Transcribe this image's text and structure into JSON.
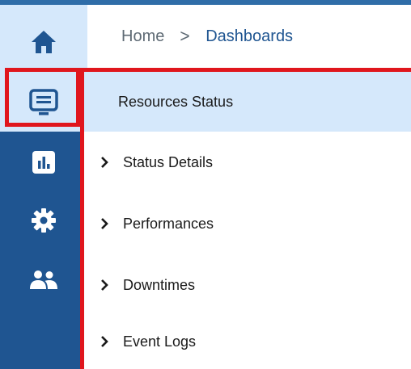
{
  "nav": {
    "items": [
      {
        "name": "home",
        "icon": "home-icon"
      },
      {
        "name": "dashboards",
        "icon": "monitor-icon",
        "active": true
      },
      {
        "name": "reports",
        "icon": "bar-chart-icon"
      },
      {
        "name": "settings",
        "icon": "gear-icon"
      },
      {
        "name": "users",
        "icon": "users-icon"
      }
    ]
  },
  "breadcrumb": {
    "home": "Home",
    "separator": ">",
    "current": "Dashboards"
  },
  "menu": {
    "items": [
      {
        "label": "Resources Status",
        "selected": true,
        "expandable": false
      },
      {
        "label": "Status Details",
        "expandable": true
      },
      {
        "label": "Performances",
        "expandable": true
      },
      {
        "label": "Downtimes",
        "expandable": true
      },
      {
        "label": "Event Logs",
        "expandable": true
      }
    ]
  },
  "colors": {
    "rail": "#1f5591",
    "highlight_bg": "#d5e8fb",
    "annotation_red": "#e0161d",
    "breadcrumb_link": "#1f5591"
  }
}
